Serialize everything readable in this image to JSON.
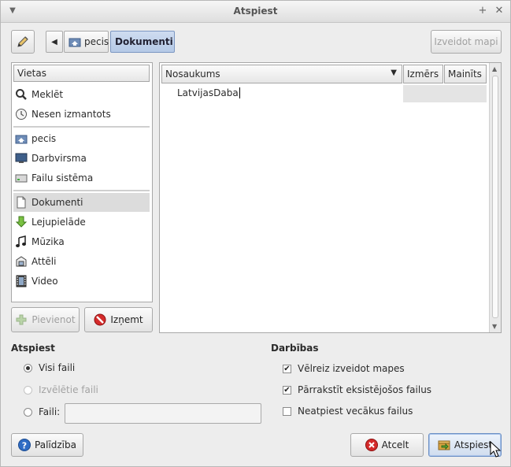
{
  "window": {
    "title": "Atspiest"
  },
  "toolbar": {
    "create_folder_label": "Izveidot mapi"
  },
  "path": {
    "segments": [
      "pecis",
      "Dokumenti"
    ]
  },
  "places": {
    "header": "Vietas",
    "items": [
      {
        "label": "Meklēt",
        "icon": "search-icon"
      },
      {
        "label": "Nesen izmantots",
        "icon": "recent-icon"
      },
      {
        "label": "pecis",
        "icon": "home-folder-icon"
      },
      {
        "label": "Darbvirsma",
        "icon": "desktop-icon"
      },
      {
        "label": "Failu sistēma",
        "icon": "filesystem-icon"
      },
      {
        "label": "Dokumenti",
        "icon": "document-icon",
        "selected": true
      },
      {
        "label": "Lejupielāde",
        "icon": "download-icon"
      },
      {
        "label": "Mūzika",
        "icon": "music-icon"
      },
      {
        "label": "Attēli",
        "icon": "pictures-icon"
      },
      {
        "label": "Video",
        "icon": "video-icon"
      }
    ],
    "add_label": "Pievienot",
    "remove_label": "Izņemt"
  },
  "files": {
    "columns": [
      "Nosaukums",
      "Izmērs",
      "Mainīts"
    ],
    "rows": [
      {
        "name": "LatvijasDaba",
        "size": "",
        "modified": ""
      }
    ]
  },
  "extract": {
    "title": "Atspiest",
    "options": [
      {
        "label": "Visi faili",
        "selected": true,
        "enabled": true
      },
      {
        "label": "Izvēlētie faili",
        "selected": false,
        "enabled": false
      },
      {
        "label": "Faili:",
        "selected": false,
        "enabled": true
      }
    ],
    "files_value": ""
  },
  "actions": {
    "title": "Darbības",
    "options": [
      {
        "label": "Vēlreiz izveidot mapes",
        "checked": true
      },
      {
        "label": "Pārrakstīt eksistējošos failus",
        "checked": true
      },
      {
        "label": "Neatpiest vecākus failus",
        "checked": false
      }
    ]
  },
  "buttons": {
    "help": "Palīdzība",
    "cancel": "Atcelt",
    "extract": "Atspiest"
  }
}
